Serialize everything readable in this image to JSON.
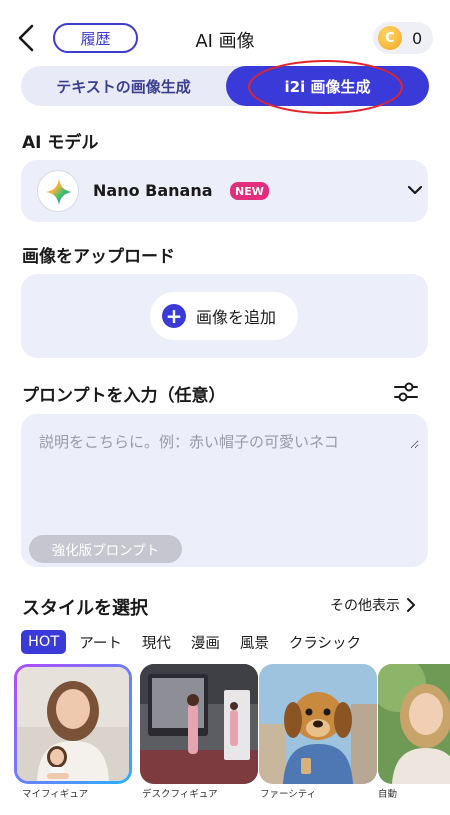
{
  "header": {
    "title": "AI 画像",
    "history_label": "履歴",
    "coin_symbol": "C",
    "coin_count": "0"
  },
  "mode_tabs": [
    {
      "label": "テキストの画像生成"
    },
    {
      "label": "i2i 画像生成"
    }
  ],
  "model_section": {
    "label": "AI モデル",
    "model_name": "Nano Banana",
    "badge": "NEW"
  },
  "upload_section": {
    "label": "画像をアップロード",
    "add_label": "画像を追加"
  },
  "prompt_section": {
    "label": "プロンプトを入力（任意）",
    "placeholder": "説明をこちらに。例：赤い帽子の可愛いネコ",
    "value": "",
    "enhance_label": "強化版プロンプト"
  },
  "style_section": {
    "label": "スタイルを選択",
    "see_more": "その他表示",
    "tabs": [
      "HOT",
      "アート",
      "現代",
      "漫画",
      "風景",
      "クラシック"
    ],
    "thumbnails": [
      {
        "label": "マイフィギュア"
      },
      {
        "label": "デスクフィギュア"
      },
      {
        "label": "ファーシティ"
      },
      {
        "label": "自動"
      }
    ]
  },
  "colors": {
    "accent": "#3a3ad9",
    "annotation_red": "#e2242b",
    "badge_pink": "#e22e7c",
    "card_bg": "#eceef9"
  }
}
